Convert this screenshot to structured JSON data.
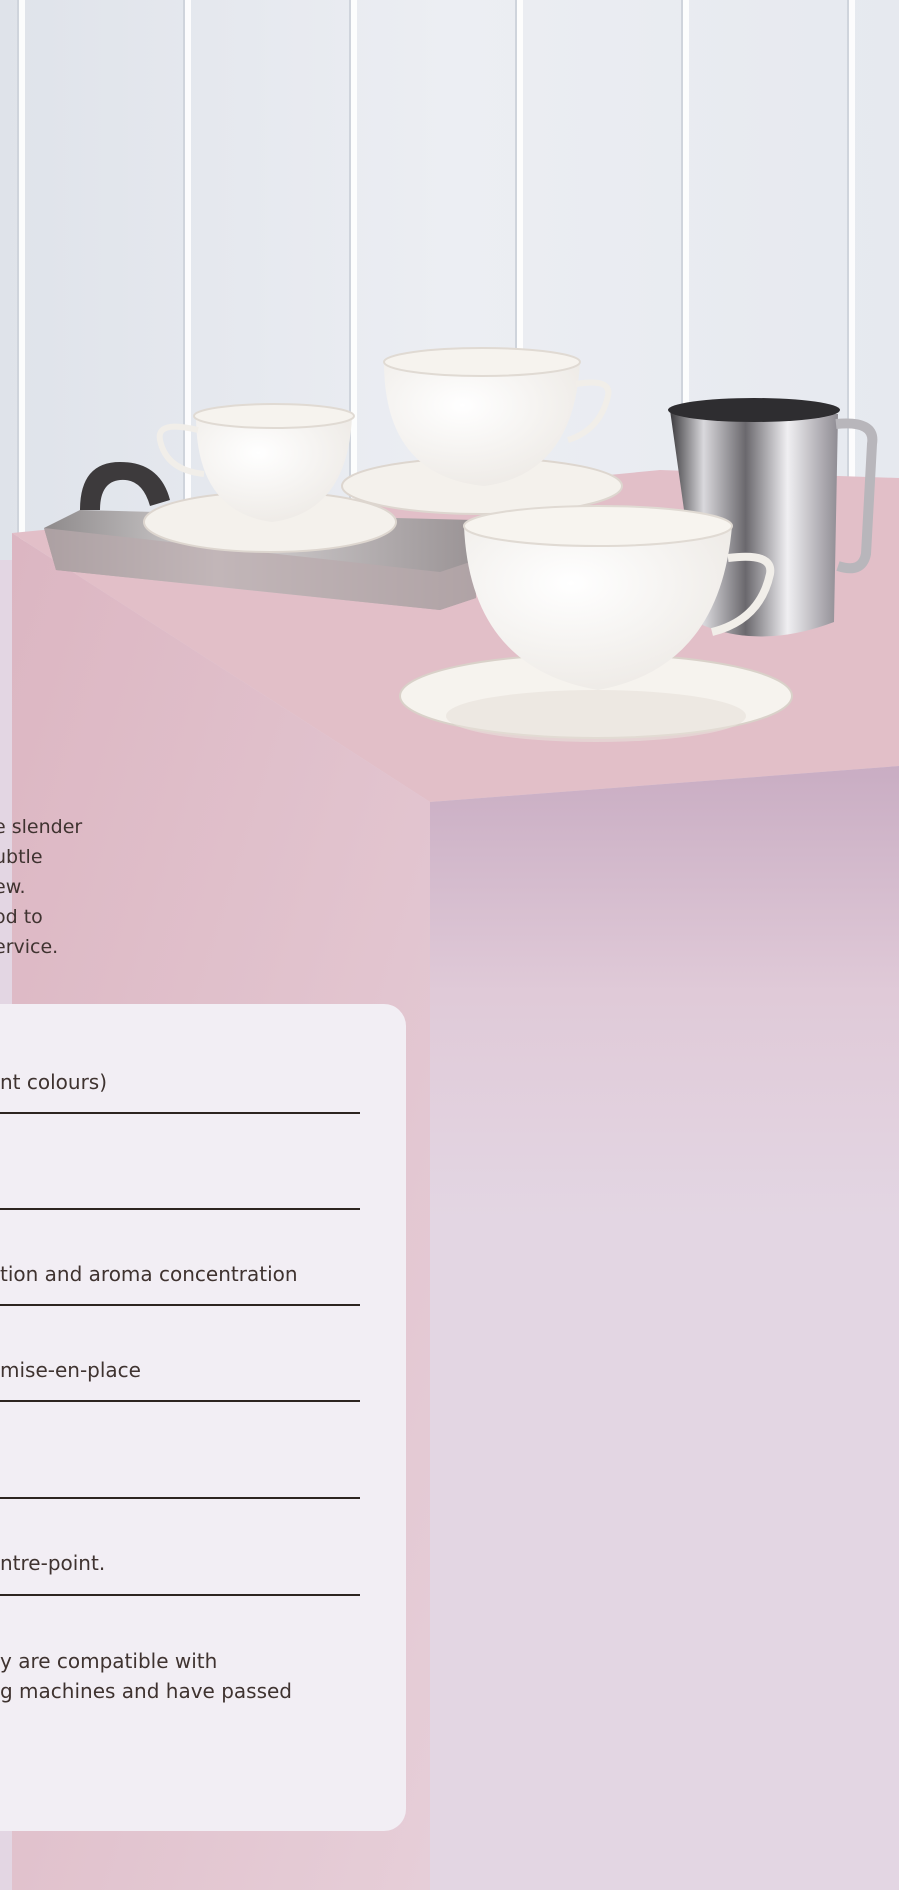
{
  "intro": {
    "lines": [
      "e slender",
      "ubtle",
      "ew.",
      "od to",
      "ervice."
    ]
  },
  "specs": {
    "rows": [
      "nt colours)",
      "",
      "tion and aroma concentration",
      "mise-en-place",
      "",
      "ntre-point."
    ],
    "note_lines": [
      "y are compatible with",
      "g machines and have passed"
    ]
  },
  "colors": {
    "wall": "#e9ecf1",
    "table_top": "#e2bfc8",
    "table_front": "#d9bccb",
    "panel": "#f2eef4",
    "text": "#3f3330"
  }
}
